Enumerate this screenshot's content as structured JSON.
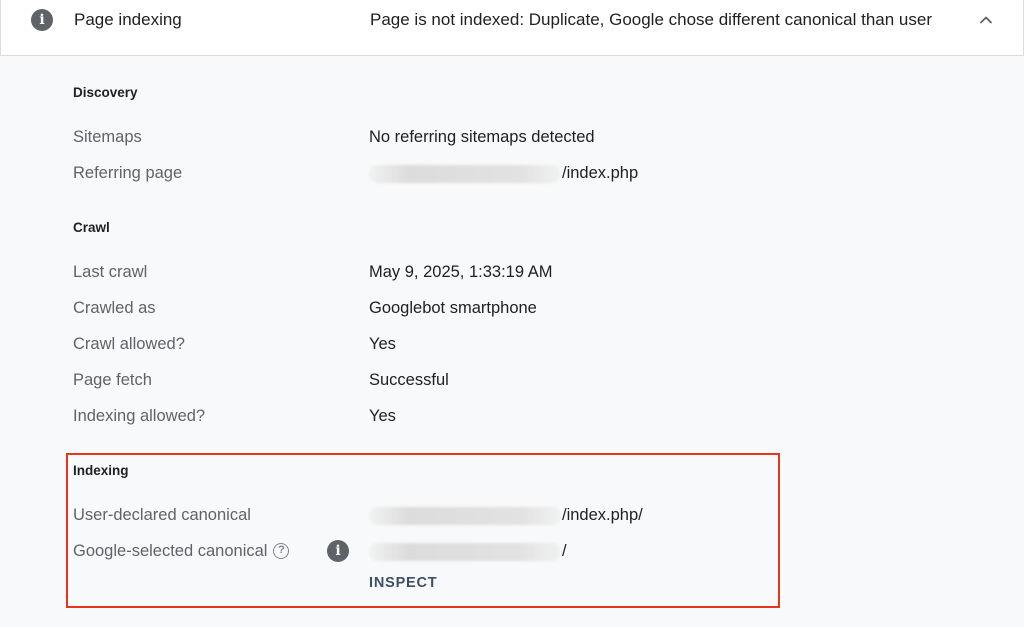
{
  "header": {
    "title": "Page indexing",
    "status": "Page is not indexed: Duplicate, Google chose different canonical than user"
  },
  "discovery": {
    "heading": "Discovery",
    "sitemaps_label": "Sitemaps",
    "sitemaps_value": "No referring sitemaps detected",
    "referring_label": "Referring page",
    "referring_value": "/index.php"
  },
  "crawl": {
    "heading": "Crawl",
    "last_crawl_label": "Last crawl",
    "last_crawl_value": "May 9, 2025, 1:33:19 AM",
    "crawled_as_label": "Crawled as",
    "crawled_as_value": "Googlebot smartphone",
    "crawl_allowed_label": "Crawl allowed?",
    "crawl_allowed_value": "Yes",
    "page_fetch_label": "Page fetch",
    "page_fetch_value": "Successful",
    "indexing_allowed_label": "Indexing allowed?",
    "indexing_allowed_value": "Yes"
  },
  "indexing": {
    "heading": "Indexing",
    "user_canonical_label": "User-declared canonical",
    "user_canonical_value": "/index.php/",
    "google_canonical_label": "Google-selected canonical",
    "google_canonical_value": "/",
    "inspect_label": "INSPECT"
  },
  "icons": {
    "info": "info-icon",
    "chevron": "chevron-up-icon",
    "help": "help-icon"
  },
  "colors": {
    "highlight": "#e8341c",
    "icon_grey": "#5f6368",
    "label_grey": "#5f6368",
    "link": "#3c4f67"
  }
}
